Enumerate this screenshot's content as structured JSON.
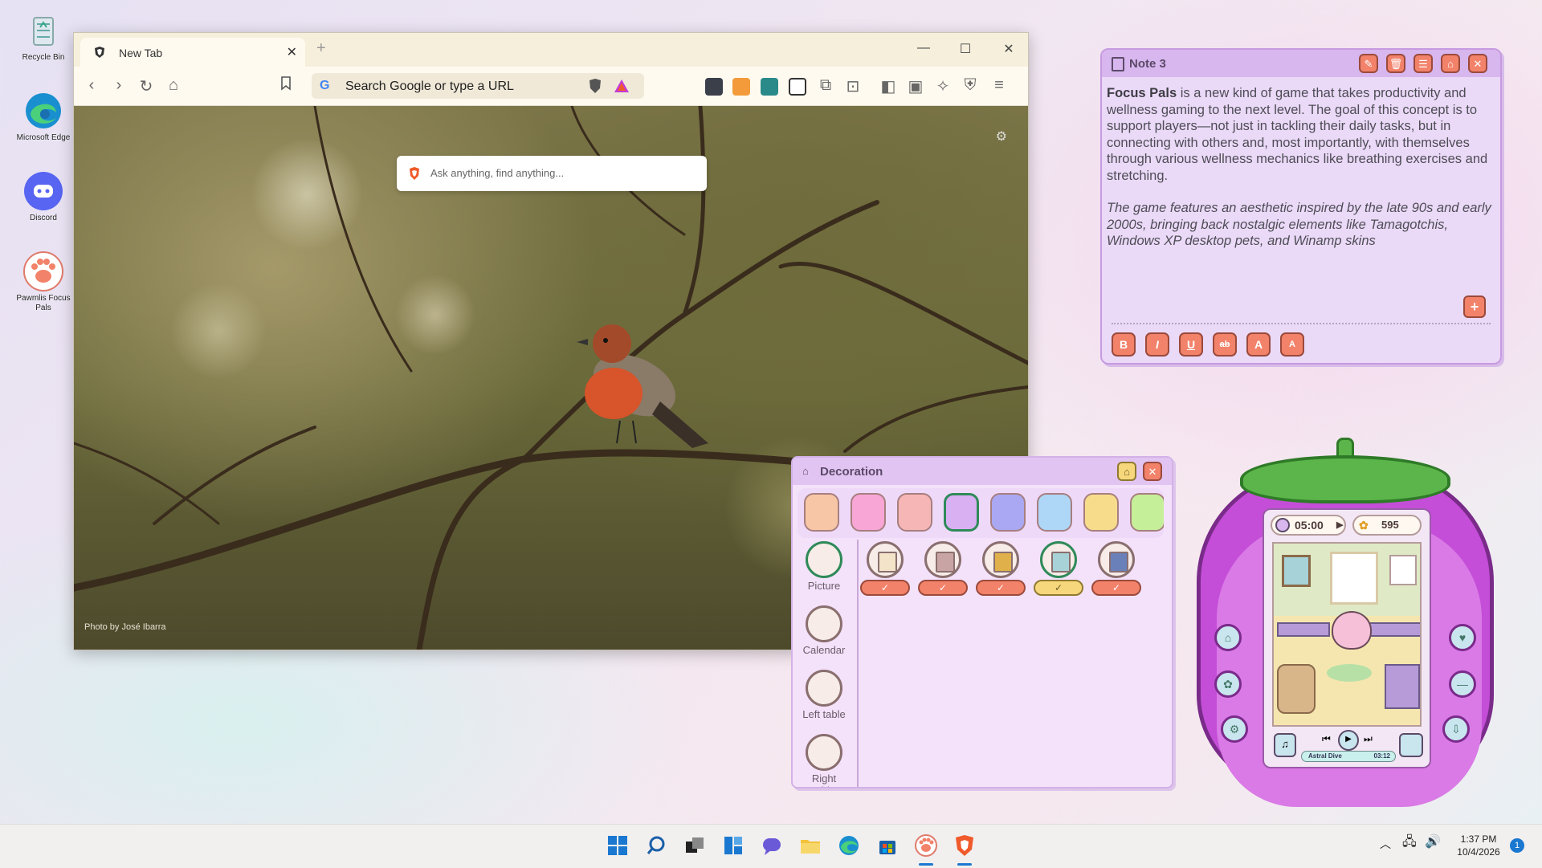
{
  "desktop": {
    "icons": [
      {
        "label": "Recycle Bin",
        "icon": "recycle-bin-icon"
      },
      {
        "label": "Microsoft Edge",
        "icon": "edge-icon"
      },
      {
        "label": "Discord",
        "icon": "discord-icon"
      },
      {
        "label": "Pawmlis Focus Pals",
        "icon": "paw-icon"
      }
    ]
  },
  "browser": {
    "tab_title": "New Tab",
    "tab_close": "✕",
    "new_tab": "+",
    "window_controls": {
      "minimize": "—",
      "maximize": "☐",
      "close": "✕"
    },
    "omnibox_placeholder": "Search Google or type a URL",
    "search_placeholder": "Ask anything, find anything...",
    "photo_credit": "Photo by José Ibarra",
    "settings_glyph": "⚙"
  },
  "note": {
    "title": "Note 3",
    "bold_lead": "Focus Pals",
    "paragraph1": " is a new kind of game that takes productivity and wellness gaming to the next level. The goal of this concept is to support players—not just in tackling their daily tasks, but in connecting with others and, most importantly, with themselves through various wellness mechanics like breathing exercises and stretching.",
    "paragraph2": "The game features an aesthetic inspired by the late 90s and early 2000s, bringing back nostalgic elements like Tamagotchis, Windows XP desktop pets, and Winamp skins",
    "add_button": "+",
    "header_buttons": [
      "✎",
      "🗑",
      "☰",
      "⌂",
      "✕"
    ],
    "format_buttons": [
      "B",
      "I",
      "U",
      "ab",
      "A",
      "A"
    ]
  },
  "decoration": {
    "title": "Decoration",
    "swatches": [
      "#f7c6a6",
      "#f7a6d6",
      "#f7b6b6",
      "#d9b0f2",
      "#aaa8f2",
      "#aed6f7",
      "#f7dc8c",
      "#c6ef9a"
    ],
    "selected_swatch": 3,
    "categories": [
      "Picture",
      "Calendar",
      "Left table",
      "Right table"
    ],
    "selected_category": 0,
    "items_count_shown": 5,
    "selected_item": 3,
    "check": "✓"
  },
  "device": {
    "timer": "05:00",
    "coins": "595",
    "song_title": "Astral Dive",
    "song_time": "03:12"
  },
  "taskbar": {
    "time": "1:37 PM",
    "date": "10/4/2026",
    "notification_count": "1",
    "chevron": "︿"
  }
}
